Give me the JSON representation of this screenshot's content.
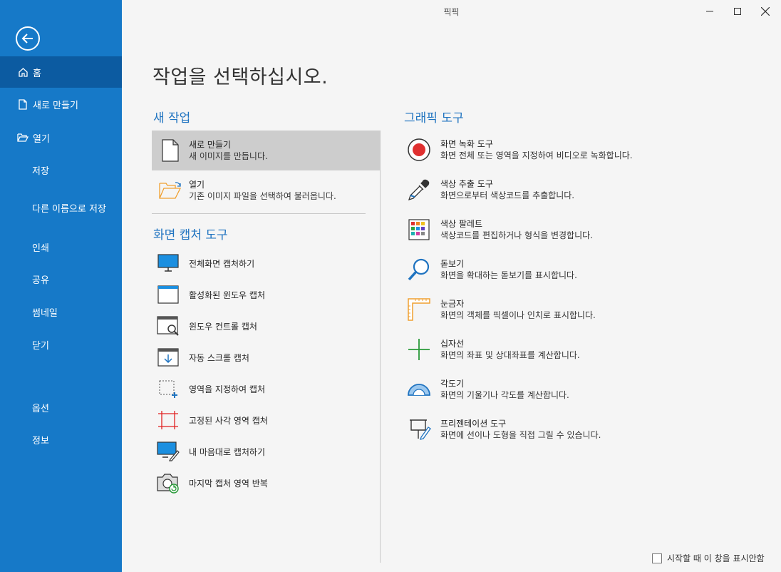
{
  "window": {
    "title": "픽픽"
  },
  "sidebar": {
    "items": [
      {
        "label": "홈",
        "icon": "home-icon",
        "active": true
      },
      {
        "label": "새로 만들기",
        "icon": "new-file-icon"
      },
      {
        "label": "열기",
        "icon": "open-folder-icon"
      },
      {
        "label": "저장"
      },
      {
        "label": "다른 이름으로 저장"
      },
      {
        "label": "인쇄"
      },
      {
        "label": "공유"
      },
      {
        "label": "썸네일"
      },
      {
        "label": "닫기"
      },
      {
        "label": "옵션"
      },
      {
        "label": "정보"
      }
    ]
  },
  "main": {
    "heading": "작업을 선택하십시오.",
    "new_task": {
      "title": "새 작업",
      "items": [
        {
          "title": "새로 만들기",
          "desc": "새 이미지를 만듭니다.",
          "icon": "blank-document-icon"
        },
        {
          "title": "열기",
          "desc": "기존 이미지 파일을 선택하여 불러옵니다.",
          "icon": "open-folder-icon"
        }
      ]
    },
    "capture": {
      "title": "화면 캡처 도구",
      "items": [
        {
          "label": "전체화면 캡처하기",
          "icon": "fullscreen-monitor-icon"
        },
        {
          "label": "활성화된 윈도우 캡처",
          "icon": "active-window-icon"
        },
        {
          "label": "윈도우 컨트롤 캡처",
          "icon": "window-control-icon"
        },
        {
          "label": "자동 스크롤 캡처",
          "icon": "scroll-capture-icon"
        },
        {
          "label": "영역을 지정하여 캡처",
          "icon": "region-select-icon"
        },
        {
          "label": "고정된 사각 영역 캡처",
          "icon": "fixed-region-icon"
        },
        {
          "label": "내 마음대로 캡처하기",
          "icon": "freehand-capture-icon"
        },
        {
          "label": "마지막 캡처 영역 반복",
          "icon": "repeat-capture-icon"
        }
      ]
    },
    "graphics": {
      "title": "그래픽 도구",
      "items": [
        {
          "title": "화면 녹화 도구",
          "desc": "화면 전체 또는 영역을 지정하여 비디오로 녹화합니다.",
          "icon": "record-icon"
        },
        {
          "title": "색상 추출 도구",
          "desc": "화면으로부터 색상코드를 추출합니다.",
          "icon": "eyedropper-icon"
        },
        {
          "title": "색상 팔레트",
          "desc": "색상코드를 편집하거나 형식을 변경합니다.",
          "icon": "palette-grid-icon"
        },
        {
          "title": "돋보기",
          "desc": "화면을 확대하는 돋보기를 표시합니다.",
          "icon": "magnifier-icon"
        },
        {
          "title": "눈금자",
          "desc": "화면의 객체를 픽셀이나 인치로 표시합니다.",
          "icon": "ruler-icon"
        },
        {
          "title": "십자선",
          "desc": "화면의 좌표 및 상대좌표를 계산합니다.",
          "icon": "crosshair-icon"
        },
        {
          "title": "각도기",
          "desc": "화면의 기울기나 각도를 계산합니다.",
          "icon": "protractor-icon"
        },
        {
          "title": "프리젠테이션 도구",
          "desc": "화면에 선이나 도형을 직접 그릴 수 있습니다.",
          "icon": "presentation-board-icon"
        }
      ]
    }
  },
  "footer": {
    "startup_checkbox": "시작할 때 이 창을 표시안함",
    "checked": false
  },
  "colors": {
    "sidebar": "#1679c8",
    "sidebar_active": "#0c5ba1",
    "accent": "#1f73c0",
    "selected": "#cdcdcd"
  }
}
